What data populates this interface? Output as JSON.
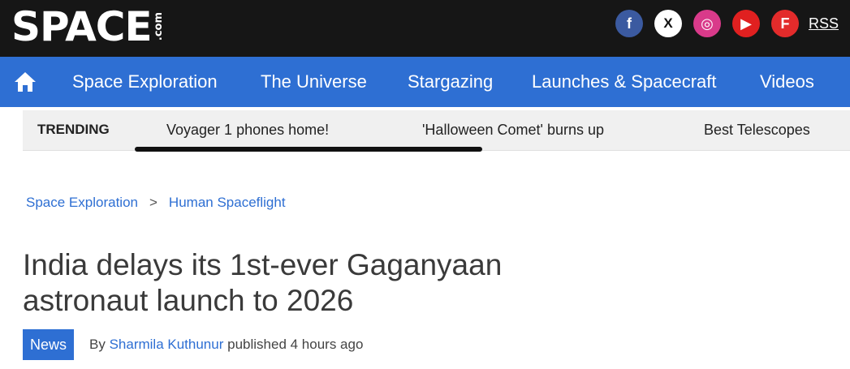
{
  "header": {
    "logo_text": "SPACE",
    "logo_suffix": ".com",
    "social": {
      "facebook": "f",
      "x": "X",
      "instagram": "◎",
      "youtube": "▶",
      "flipboard": "F",
      "rss_label": "RSS"
    }
  },
  "nav": {
    "items": [
      "Space Exploration",
      "The Universe",
      "Stargazing",
      "Launches & Spacecraft",
      "Videos"
    ]
  },
  "trending": {
    "label": "TRENDING",
    "items": [
      "Voyager 1 phones home!",
      "'Halloween Comet' burns up",
      "Best Telescopes"
    ]
  },
  "breadcrumb": {
    "items": [
      "Space Exploration",
      "Human Spaceflight"
    ],
    "separator": ">"
  },
  "article": {
    "title": "India delays its 1st-ever Gaganyaan astronaut launch to 2026",
    "badge": "News",
    "by": "By",
    "author": "Sharmila Kuthunur",
    "published": "published 4 hours ago"
  },
  "colors": {
    "brand_blue": "#2e6fd3",
    "topbar": "#161616"
  }
}
